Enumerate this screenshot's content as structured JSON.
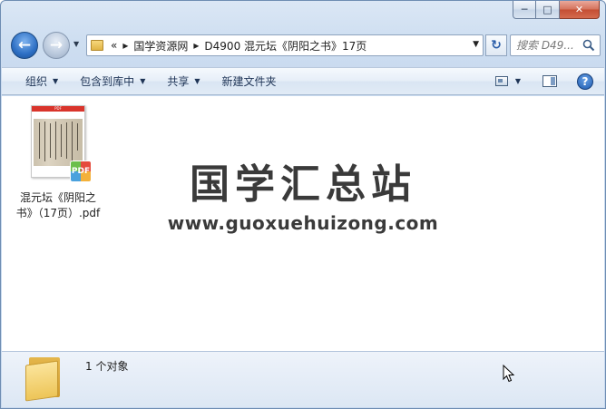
{
  "window": {
    "caption": {
      "minimize": "─",
      "maximize": "□",
      "close": "✕"
    }
  },
  "nav": {
    "back_glyph": "←",
    "forward_glyph": "→",
    "history_glyph": "▼"
  },
  "address": {
    "overflow": "«",
    "crumbs": [
      "国学资源网",
      "D4900 混元坛《阴阳之书》17页"
    ],
    "separator": "▸",
    "dropdown": "▼"
  },
  "refresh_glyph": "↻",
  "search": {
    "placeholder": "搜索 D49..."
  },
  "toolbar": {
    "organize": "组织",
    "include_in_library": "包含到库中",
    "share": "共享",
    "new_folder": "新建文件夹",
    "dropdown_glyph": "▼",
    "help_glyph": "?"
  },
  "file": {
    "thumb_label": "PDF",
    "badge": "PDF",
    "name_line1": "混元坛《阴阳之",
    "name_line2": "书》（17页）.pdf"
  },
  "watermark": {
    "title": "国学汇总站",
    "url": "www.guoxuehuizong.com"
  },
  "status": {
    "object_count": "1 个对象"
  },
  "colors": {
    "accent": "#2d6fc4",
    "close_button": "#c44d33",
    "folder": "#edc558"
  }
}
